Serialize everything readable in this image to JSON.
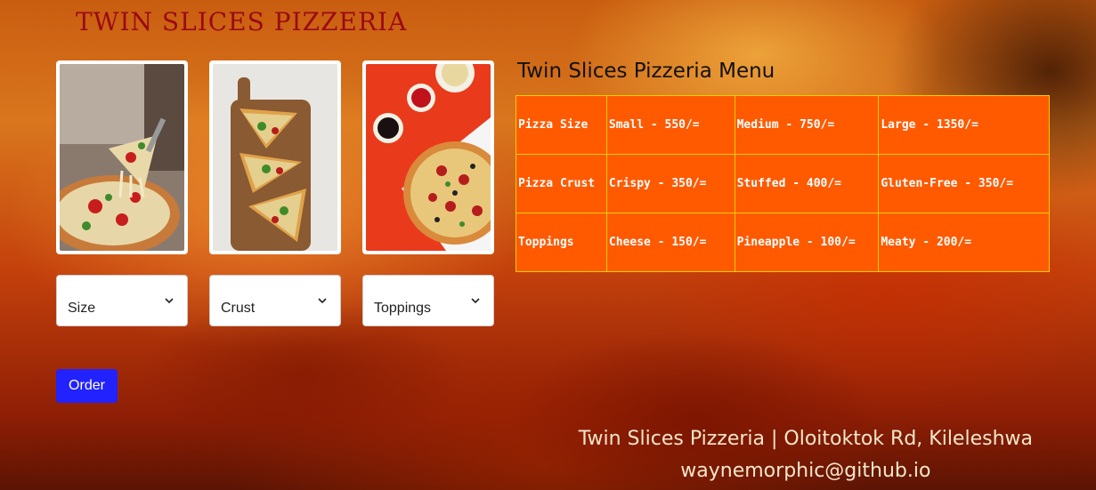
{
  "brand": {
    "name": "TWIN SLICES PIZZERIA"
  },
  "images": [
    {
      "alt": "pizza-slice-cheese-pull"
    },
    {
      "alt": "pizza-slices-on-board"
    },
    {
      "alt": "whole-pizza-on-red"
    }
  ],
  "selects": {
    "size": {
      "value": "Size"
    },
    "crust": {
      "value": "Crust"
    },
    "toppings": {
      "value": "Toppings"
    }
  },
  "order_button": {
    "label": "Order"
  },
  "menu": {
    "title": "Twin Slices Pizzeria Menu",
    "rows": [
      [
        "Pizza Size",
        "Small - 550/=",
        "Medium - 750/=",
        "Large - 1350/="
      ],
      [
        "Pizza Crust",
        "Crispy - 350/=",
        "Stuffed - 400/=",
        "Gluten-Free - 350/="
      ],
      [
        "Toppings",
        "Cheese - 150/=",
        "Pineapple - 100/=",
        "Meaty - 200/="
      ]
    ]
  },
  "footer": {
    "address": "Twin Slices Pizzeria | Oloitoktok Rd, Kileleshwa",
    "contact": "waynemorphic@github.io"
  },
  "colors": {
    "brand": "#9b0a14",
    "button": "#2222ff",
    "table_bg": "#ff5a00",
    "table_border": "#e8d000"
  }
}
